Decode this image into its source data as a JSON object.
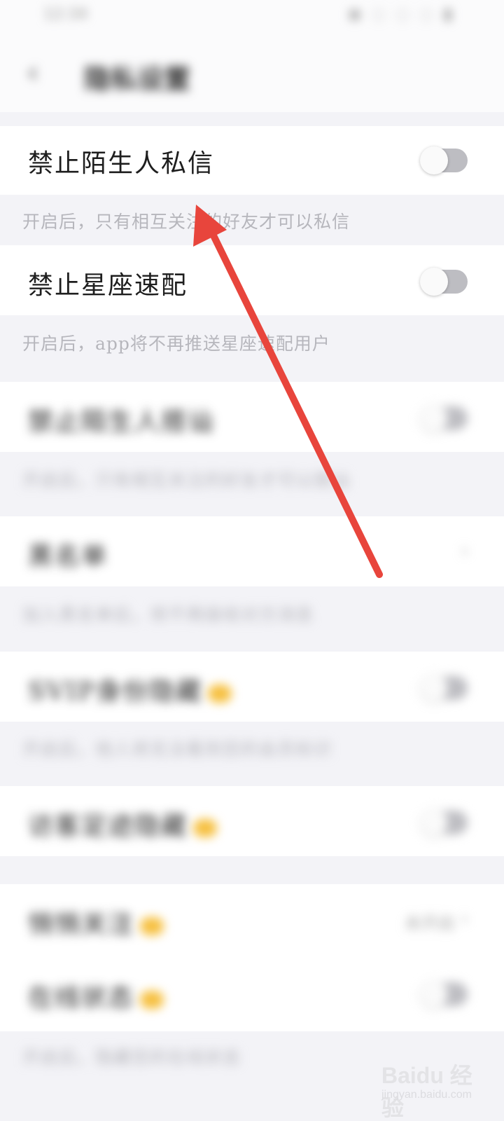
{
  "status_bar": {
    "time": "12:34",
    "icons": "◉ ◌ ◌ ◌ ▮"
  },
  "header": {
    "back_icon": "chevron-left",
    "title": "隐私设置"
  },
  "settings": [
    {
      "label": "禁止陌生人私信",
      "hint": "开启后，只有相互关注的好友才可以私信",
      "control": "toggle",
      "on": false
    },
    {
      "label": "禁止星座速配",
      "hint": "开启后，app将不再推送星座速配用户",
      "control": "toggle",
      "on": false
    }
  ],
  "blurred_settings": [
    {
      "label": "禁止陌生人搭讪",
      "hint": "开启后，只有相互关注的好友才可以搭讪",
      "control": "toggle"
    },
    {
      "label": "黑名单",
      "hint": "加入黑名单后，将不再接收对方消息",
      "control": "chevron"
    },
    {
      "label": "SVIP身份隐藏",
      "hint": "开启后，他人将无法看到您的会员标识",
      "control": "toggle",
      "crown": true
    },
    {
      "label": "访客足迹隐藏",
      "hint": "",
      "control": "toggle",
      "crown": true
    },
    {
      "label": "悄悄关注",
      "hint": "",
      "control": "value",
      "value": "未开启",
      "crown": true
    },
    {
      "label": "在线状态",
      "hint": "开启后，隐藏您的在线状态",
      "control": "toggle",
      "crown": true
    }
  ],
  "annotation": {
    "type": "red-arrow",
    "color": "#e8453c"
  },
  "watermark": {
    "logo": "Baidu 经验",
    "url": "jingyan.baidu.com"
  }
}
